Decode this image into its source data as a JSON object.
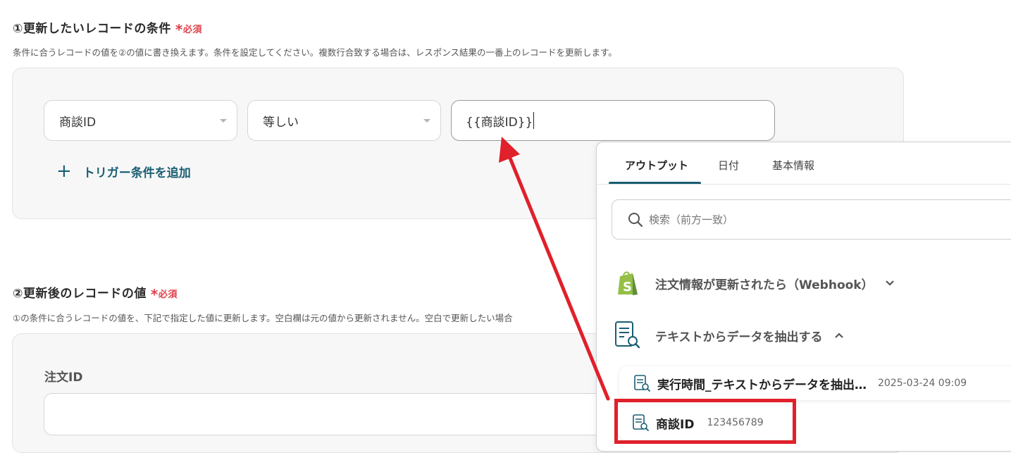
{
  "section1": {
    "title": "①更新したいレコードの条件",
    "required_mark": "*",
    "required": "必須",
    "description": "条件に合うレコードの値を②の値に書き換えます。条件を設定してください。複数行合致する場合は、レスポンス結果の一番上のレコードを更新します。",
    "condition": {
      "field": "商談ID",
      "operator": "等しい",
      "value": "{{商談ID}}"
    },
    "add_condition": "トリガー条件を追加"
  },
  "section2": {
    "title": "②更新後のレコードの値",
    "required_mark": "*",
    "required": "必須",
    "description": "①の条件に合うレコードの値を、下記で指定した値に更新します。空白欄は元の値から更新されません。空白で更新したい場合",
    "field_label": "注文ID",
    "field_value": ""
  },
  "popup": {
    "tabs": [
      "アウトプット",
      "日付",
      "基本情報"
    ],
    "active_tab": "アウトプット",
    "search_placeholder": "検索（前方一致）",
    "groups": [
      {
        "name": "注文情報が更新されたら（Webhook）",
        "icon": "shopify-icon",
        "expanded": false
      },
      {
        "name": "テキストからデータを抽出する",
        "icon": "document-search-icon",
        "expanded": true
      }
    ],
    "items": [
      {
        "name": "実行時間_テキストからデータを抽出…",
        "value": "2025-03-24 09:09"
      },
      {
        "name": "商談ID",
        "value": "123456789"
      }
    ]
  },
  "colors": {
    "accent": "#1a5e72",
    "required": "#e0404a",
    "annotation": "#e0202a",
    "shopify_green": "#95bf47"
  }
}
